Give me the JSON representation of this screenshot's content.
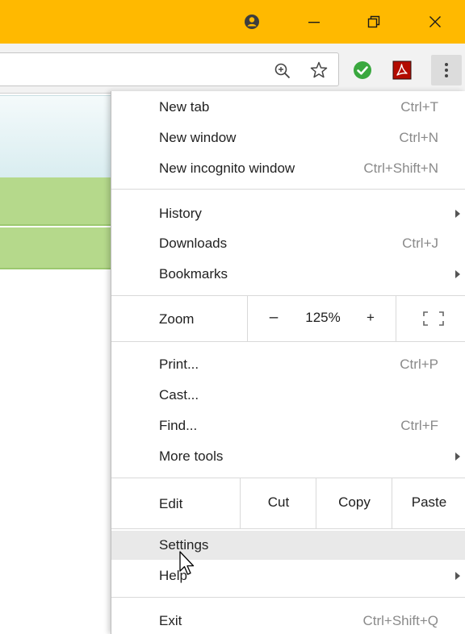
{
  "window": {
    "accent_color": "#ffb900"
  },
  "menu": {
    "new_tab": {
      "label": "New tab",
      "shortcut": "Ctrl+T"
    },
    "new_window": {
      "label": "New window",
      "shortcut": "Ctrl+N"
    },
    "new_incognito": {
      "label": "New incognito window",
      "shortcut": "Ctrl+Shift+N"
    },
    "history": {
      "label": "History"
    },
    "downloads": {
      "label": "Downloads",
      "shortcut": "Ctrl+J"
    },
    "bookmarks": {
      "label": "Bookmarks"
    },
    "zoom": {
      "label": "Zoom",
      "minus": "–",
      "value": "125%",
      "plus": "+"
    },
    "print": {
      "label": "Print...",
      "shortcut": "Ctrl+P"
    },
    "cast": {
      "label": "Cast..."
    },
    "find": {
      "label": "Find...",
      "shortcut": "Ctrl+F"
    },
    "more_tools": {
      "label": "More tools"
    },
    "edit": {
      "label": "Edit",
      "cut": "Cut",
      "copy": "Copy",
      "paste": "Paste"
    },
    "settings": {
      "label": "Settings"
    },
    "help": {
      "label": "Help"
    },
    "exit": {
      "label": "Exit",
      "shortcut": "Ctrl+Shift+Q"
    }
  },
  "icons": {
    "titlebar": [
      "profile-icon",
      "minimize-icon",
      "restore-icon",
      "close-icon"
    ],
    "toolbar": [
      "zoom-icon",
      "bookmark-star-icon",
      "extension-check-icon",
      "pdf-extension-icon",
      "menu-dots-icon"
    ]
  }
}
